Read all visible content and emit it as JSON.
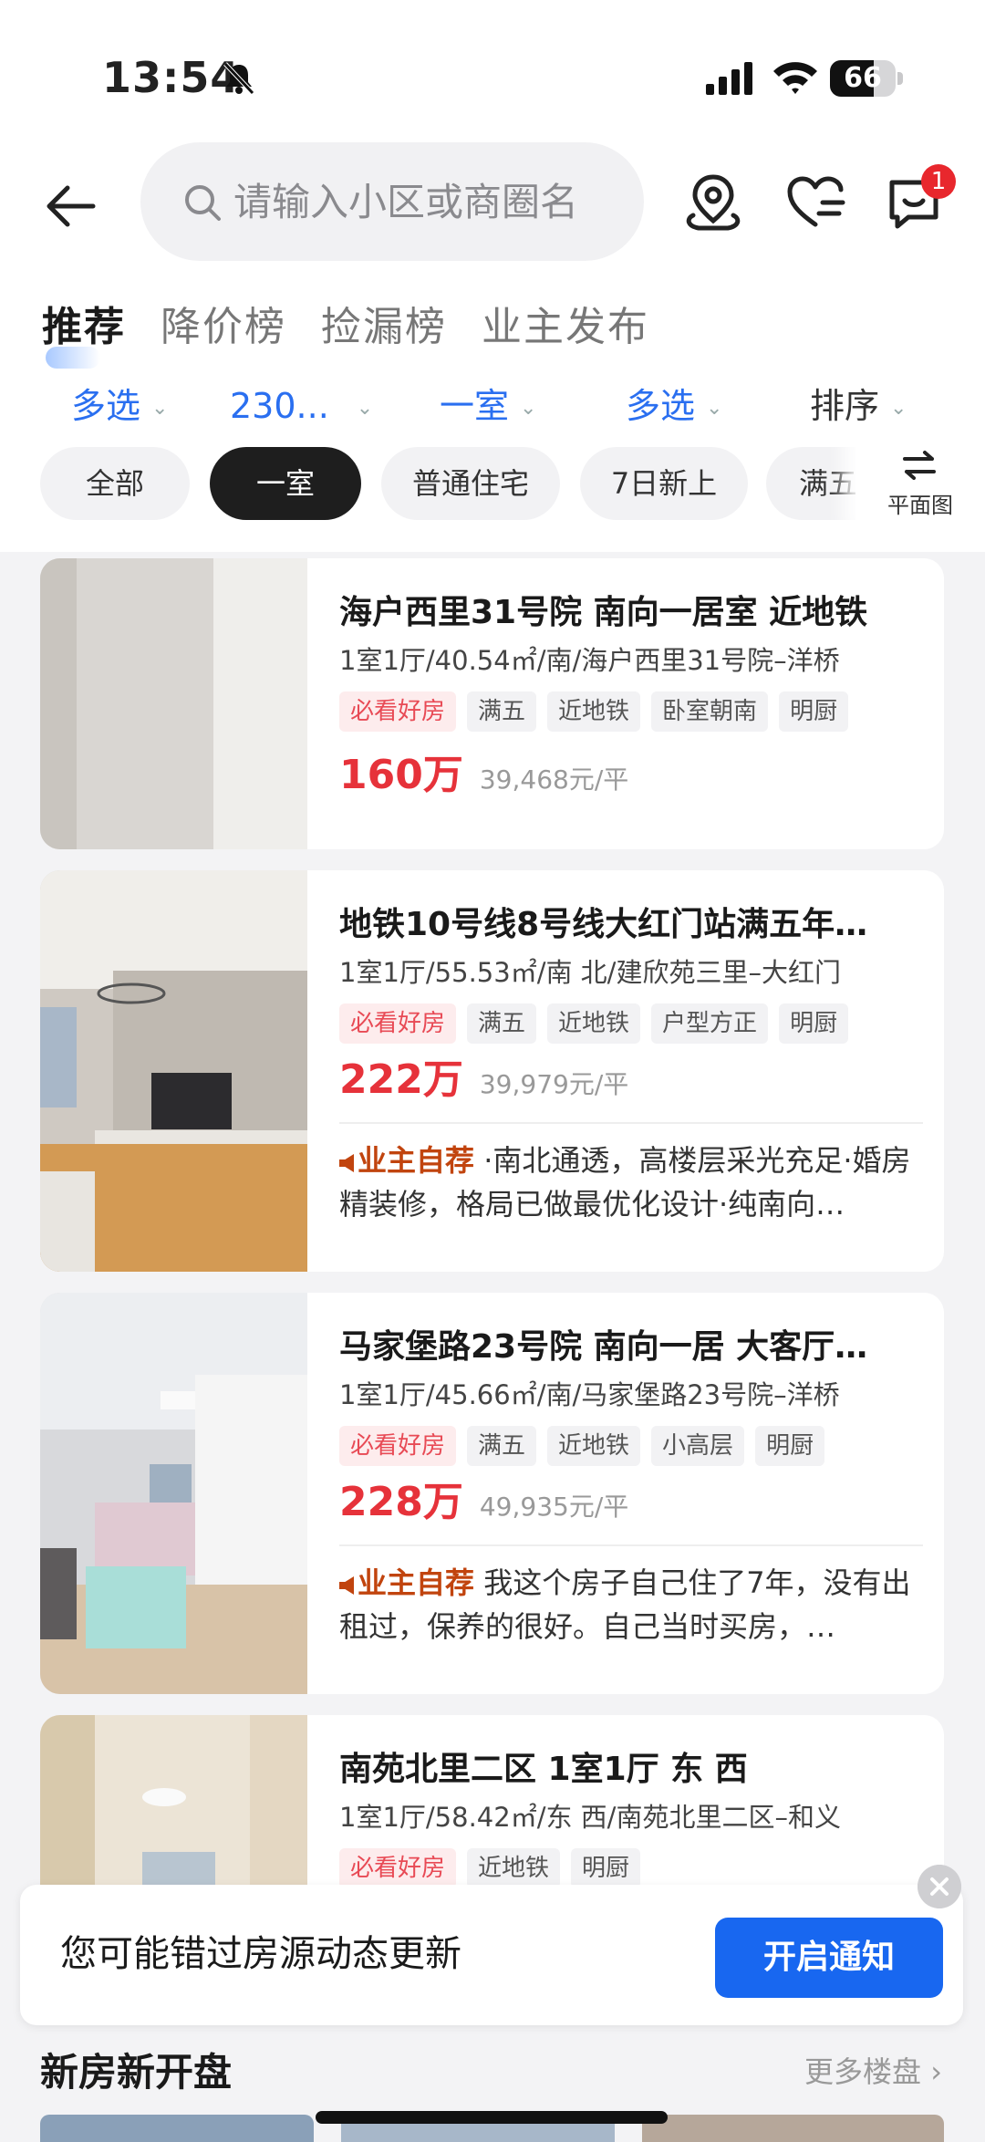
{
  "status_bar": {
    "time": "13:54",
    "battery": "66",
    "battery_fraction": 0.66
  },
  "header": {
    "search_placeholder": "请输入小区或商圈名",
    "message_badge": "1"
  },
  "tabs": [
    {
      "label": "推荐",
      "active": true
    },
    {
      "label": "降价榜",
      "active": false
    },
    {
      "label": "捡漏榜",
      "active": false
    },
    {
      "label": "业主发布",
      "active": false
    }
  ],
  "filters": [
    {
      "label": "多选"
    },
    {
      "label": "230..."
    },
    {
      "label": "一室"
    },
    {
      "label": "多选"
    },
    {
      "label": "排序"
    }
  ],
  "chips": [
    {
      "label": "全部",
      "active": false
    },
    {
      "label": "一室",
      "active": true
    },
    {
      "label": "普通住宅",
      "active": false
    },
    {
      "label": "7日新上",
      "active": false
    },
    {
      "label": "满五",
      "active": false
    }
  ],
  "plan_label": "平面图",
  "listings": [
    {
      "title": "海户西里31号院 南向一居室  近地铁",
      "meta": "1室1厅/40.54㎡/南/海户西里31号院–洋桥",
      "tags": [
        "必看好房",
        "满五",
        "近地铁",
        "卧室朝南",
        "明厨"
      ],
      "price": "160万",
      "unit_price": "39,468元/平"
    },
    {
      "title": "地铁10号线8号线大红门站满五年…",
      "meta": "1室1厅/55.53㎡/南 北/建欣苑三里–大红门",
      "tags": [
        "必看好房",
        "满五",
        "近地铁",
        "户型方正",
        "明厨"
      ],
      "price": "222万",
      "unit_price": "39,979元/平",
      "owner_label": "业主自荐",
      "note": " ·南北通透，高楼层采光充足·婚房精装修，格局已做最优化设计·纯南向…"
    },
    {
      "title": "马家堡路23号院 南向一居 大客厅…",
      "meta": "1室1厅/45.66㎡/南/马家堡路23号院–洋桥",
      "tags": [
        "必看好房",
        "满五",
        "近地铁",
        "小高层",
        "明厨"
      ],
      "price": "228万",
      "unit_price": "49,935元/平",
      "owner_label": "业主自荐",
      "note": " 我这个房子自己住了7年，没有出租过，保养的很好。自己当时买房，…"
    },
    {
      "title": "南苑北里二区 1室1厅 东 西",
      "meta": "1室1厅/58.42㎡/东 西/南苑北里二区–和义",
      "tags": [
        "必看好房",
        "近地铁",
        "明厨"
      ]
    }
  ],
  "notify": {
    "text": "您可能错过房源动态更新",
    "button": "开启通知"
  },
  "new_house": {
    "title": "新房新开盘",
    "more": "更多楼盘"
  },
  "colors": {
    "accent": "#1867f0",
    "price": "#e6323a",
    "owner": "#c1440e"
  }
}
